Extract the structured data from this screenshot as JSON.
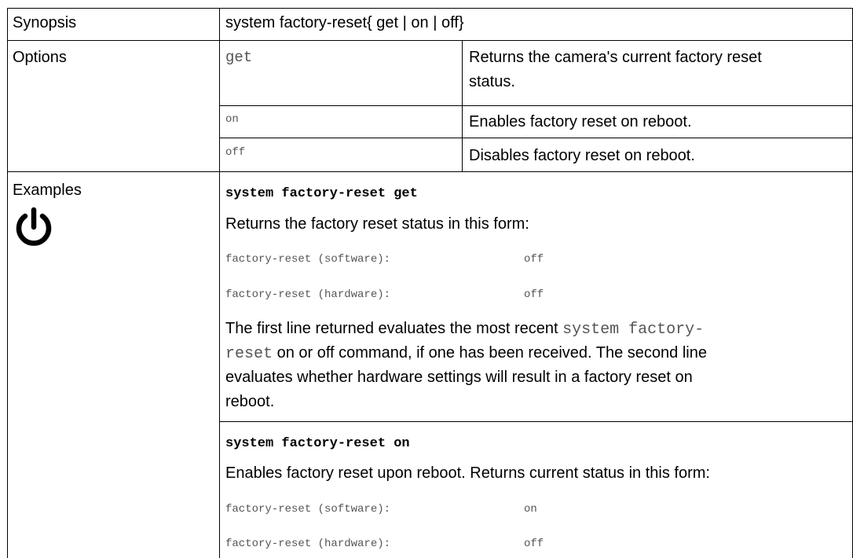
{
  "synopsis": {
    "label": "Synopsis",
    "value": "system factory-reset{ get | on | off}"
  },
  "options": {
    "label": "Options",
    "rows": [
      {
        "arg": "get",
        "desc_line1": "Returns the camera's current factory reset",
        "desc_line2": "status."
      },
      {
        "arg": "on",
        "desc": "Enables factory reset on reboot."
      },
      {
        "arg": "off",
        "desc": "Disables factory reset on reboot."
      }
    ]
  },
  "examples": {
    "label": "Examples",
    "icon": "power-icon",
    "blocks": [
      {
        "command": "system factory-reset get",
        "intro": "Returns the factory reset status in this form:",
        "output": [
          {
            "key": "factory-reset (software):",
            "val": "off"
          },
          {
            "key": "factory-reset (hardware):",
            "val": "off"
          }
        ],
        "note": {
          "l1_pre": "The first line returned evaluates the most recent ",
          "l1_code": "system factory-",
          "l2_code": "reset",
          "l2_post": " on or off command, if one has been received. The second line",
          "l3": "evaluates whether hardware settings will result in a factory reset on",
          "l4": "reboot."
        }
      },
      {
        "command": "system factory-reset on",
        "intro": "Enables factory reset upon reboot. Returns current status in this form:",
        "output": [
          {
            "key": "factory-reset (software):",
            "val": "on"
          },
          {
            "key": "factory-reset (hardware):",
            "val": "off"
          }
        ]
      }
    ]
  }
}
